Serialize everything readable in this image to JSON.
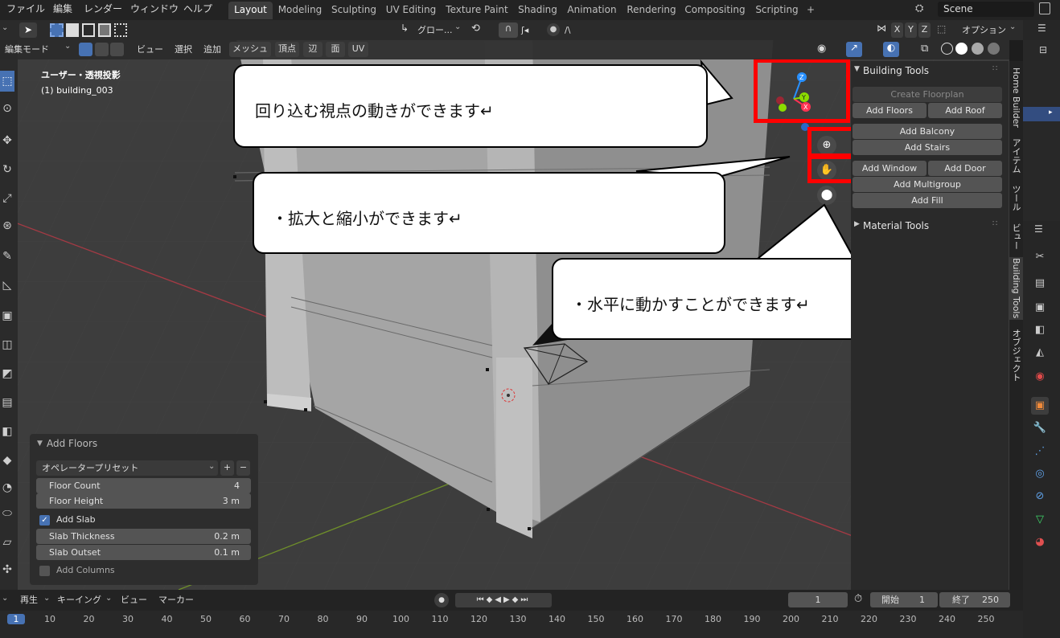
{
  "topbar": {
    "menus": [
      "ファイル",
      "編集",
      "レンダー",
      "ウィンドウ",
      "ヘルプ"
    ],
    "workspaces": [
      "Layout",
      "Modeling",
      "Sculpting",
      "UV Editing",
      "Texture Paint",
      "Shading",
      "Animation",
      "Rendering",
      "Compositing",
      "Scripting"
    ],
    "active_workspace": "Layout",
    "add_tab": "+",
    "scene_name": "Scene"
  },
  "toolrow": {
    "transform_orientation": "グロー...",
    "snap_label": "ʃ◂",
    "proportional_label": "/\\",
    "axis": [
      "X",
      "Y",
      "Z"
    ],
    "options": "オプション"
  },
  "header": {
    "mode": "編集モード",
    "menus": [
      "ビュー",
      "選択",
      "追加",
      "メッシュ",
      "頂点",
      "辺",
      "面",
      "UV"
    ]
  },
  "viewport": {
    "view_name": "ユーザー・透視投影",
    "object_name": "(1) building_003"
  },
  "gizmo": {
    "x": "X",
    "y": "Y",
    "z": "Z"
  },
  "npanel": {
    "building_tools_title": "Building Tools",
    "buttons": {
      "create_floorplan": "Create Floorplan",
      "add_floors": "Add Floors",
      "add_roof": "Add Roof",
      "add_balcony": "Add Balcony",
      "add_stairs": "Add Stairs",
      "add_window": "Add Window",
      "add_door": "Add Door",
      "add_multigroup": "Add Multigroup",
      "add_fill": "Add Fill"
    },
    "material_tools_title": "Material Tools"
  },
  "side_tabs": [
    "Home Builder",
    "アイテム",
    "ツール",
    "ビュー",
    "Building Tools",
    "オブジェクト"
  ],
  "operator_panel": {
    "title": "Add Floors",
    "preset": "オペレータープリセット",
    "plus": "+",
    "minus": "−",
    "floor_count_label": "Floor Count",
    "floor_count": "4",
    "floor_height_label": "Floor Height",
    "floor_height": "3 m",
    "add_slab_label": "Add Slab",
    "add_slab_checked": true,
    "slab_thickness_label": "Slab Thickness",
    "slab_thickness": "0.2 m",
    "slab_outset_label": "Slab Outset",
    "slab_outset": "0.1 m",
    "add_columns_label": "Add Columns",
    "add_columns_checked": false
  },
  "timeline": {
    "playback": "再生",
    "keying": "キーイング",
    "view": "ビュー",
    "marker": "マーカー",
    "current_frame": "1",
    "start_label": "開始",
    "start": "1",
    "end_label": "終了",
    "end": "250",
    "frames": [
      "1",
      "10",
      "20",
      "30",
      "40",
      "50",
      "60",
      "70",
      "80",
      "90",
      "100",
      "110",
      "120",
      "130",
      "140",
      "150",
      "160",
      "170",
      "180",
      "190",
      "200",
      "210",
      "220",
      "230",
      "240",
      "250"
    ]
  },
  "callouts": {
    "orbit": "回り込む視点の動きができます↵",
    "zoom": "・拡大と縮小ができます↵",
    "pan": "・水平に動かすことができます↵"
  },
  "colors": {
    "accent": "#4772b3",
    "highlight_red": "#ff0000",
    "axis_x": "#ff3352",
    "axis_y": "#8bdc00",
    "axis_z": "#2890ff"
  }
}
